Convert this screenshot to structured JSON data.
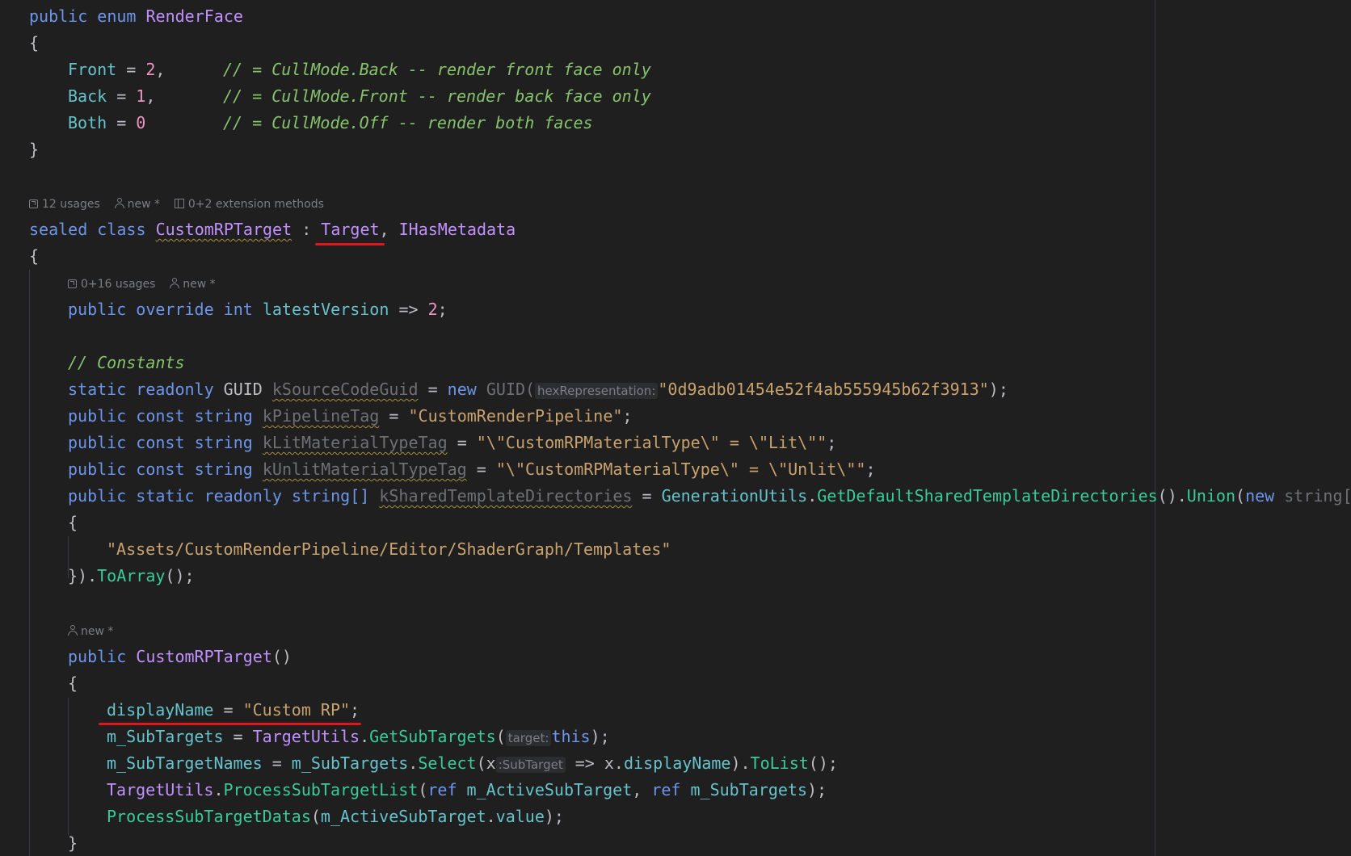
{
  "enum_block": {
    "decl": {
      "kw1": "public",
      "kw2": "enum",
      "name": "RenderFace"
    },
    "open_brace": "{",
    "members": [
      {
        "name": "Front",
        "value": "2",
        "comment": "// = CullMode.Back -- render front face only"
      },
      {
        "name": "Back",
        "value": "1",
        "comment": "// = CullMode.Front -- render back face only"
      },
      {
        "name": "Both",
        "value": "0",
        "comment": "// = CullMode.Off -- render both faces"
      }
    ],
    "close_brace": "}"
  },
  "class_hints": {
    "usages": "12 usages",
    "author": "new *",
    "extensions": "0+2 extension methods"
  },
  "class_decl": {
    "kw1": "sealed",
    "kw2": "class",
    "name": "CustomRPTarget",
    "colon": ":",
    "base": "Target",
    "comma": ",",
    "iface": "IHasMetadata",
    "open_brace": "{"
  },
  "latest_hints": {
    "usages": "0+16 usages",
    "author": "new *"
  },
  "latest_version": {
    "kw1": "public",
    "kw2": "override",
    "type": "int",
    "name": "latestVersion",
    "arrow": "=>",
    "value": "2",
    "semi": ";"
  },
  "constants_comment": "// Constants",
  "guid_line": {
    "kw1": "static",
    "kw2": "readonly",
    "type": "GUID",
    "name": "kSourceCodeGuid",
    "eq": "=",
    "kw_new": "new",
    "ctor": "GUID(",
    "param_hint": "hexRepresentation:",
    "value": "\"0d9adb01454e52f4ab555945b62f3913\"",
    "end": ");"
  },
  "const_lines": [
    {
      "kw1": "public",
      "kw2": "const",
      "type": "string",
      "name": "kPipelineTag",
      "eq": "=",
      "value": "\"CustomRenderPipeline\"",
      "semi": ";"
    },
    {
      "kw1": "public",
      "kw2": "const",
      "type": "string",
      "name": "kLitMaterialTypeTag",
      "eq": "=",
      "value": "\"\\\"CustomRPMaterialType\\\" = \\\"Lit\\\"\"",
      "semi": ";"
    },
    {
      "kw1": "public",
      "kw2": "const",
      "type": "string",
      "name": "kUnlitMaterialTypeTag",
      "eq": "=",
      "value": "\"\\\"CustomRPMaterialType\\\" = \\\"Unlit\\\"\"",
      "semi": ";"
    }
  ],
  "shared_dirs_line": {
    "kw1": "public",
    "kw2": "static",
    "kw3": "readonly",
    "type": "string[]",
    "name": "kSharedTemplateDirectories",
    "eq": "=",
    "util_class": "GenerationUtils",
    "dot": ".",
    "method": "GetDefaultSharedTemplateDirectories",
    "call": "().",
    "union": "Union",
    "paren": "(",
    "kw_new": "new",
    "type2": "string[]"
  },
  "shared_dirs_open": "{",
  "shared_dirs_value": "\"Assets/CustomRenderPipeline/Editor/ShaderGraph/Templates\"",
  "shared_dirs_close": {
    "brace": "}).",
    "method": "ToArray",
    "end": "();"
  },
  "ctor_hints": {
    "author": "new *"
  },
  "ctor_decl": {
    "kw": "public",
    "name": "CustomRPTarget",
    "parens": "()"
  },
  "ctor_open": "{",
  "ctor_body": {
    "display_name": {
      "field": "displayName",
      "eq": "=",
      "value": "\"Custom RP\"",
      "semi": ";"
    },
    "subtargets": {
      "field": "m_SubTargets",
      "eq": "=",
      "cls": "TargetUtils",
      "dot": ".",
      "method": "GetSubTargets",
      "paren": "(",
      "hint": "target:",
      "kw": "this",
      "end": ");"
    },
    "subtarget_names": {
      "field": "m_SubTargetNames",
      "eq": "=",
      "src": "m_SubTargets",
      "dot": ".",
      "method": "Select",
      "paren": "(x",
      "hint": ":SubTarget",
      "arrow": "=>",
      "x": "x.",
      "prop": "displayName",
      "close": ").",
      "method2": "ToList",
      "end": "();"
    },
    "process_list": {
      "cls": "TargetUtils",
      "dot": ".",
      "method": "ProcessSubTargetList",
      "paren": "(",
      "kw1": "ref",
      "arg1": "m_ActiveSubTarget",
      "comma": ",",
      "kw2": "ref",
      "arg2": "m_SubTargets",
      "end": ");"
    },
    "process_datas": {
      "method": "ProcessSubTargetDatas",
      "paren": "(",
      "arg": "m_ActiveSubTarget",
      "dot": ".",
      "prop": "value",
      "end": ");"
    }
  },
  "ctor_close": "}",
  "colors": {
    "background": "#1f1f1f",
    "keyword": "#6c95eb",
    "type": "#c191ff",
    "field": "#66c3cc",
    "method": "#39cc9b",
    "string": "#c9a26d",
    "number": "#ed94c0",
    "comment": "#85c46c",
    "annotation_red": "#e0161b"
  }
}
